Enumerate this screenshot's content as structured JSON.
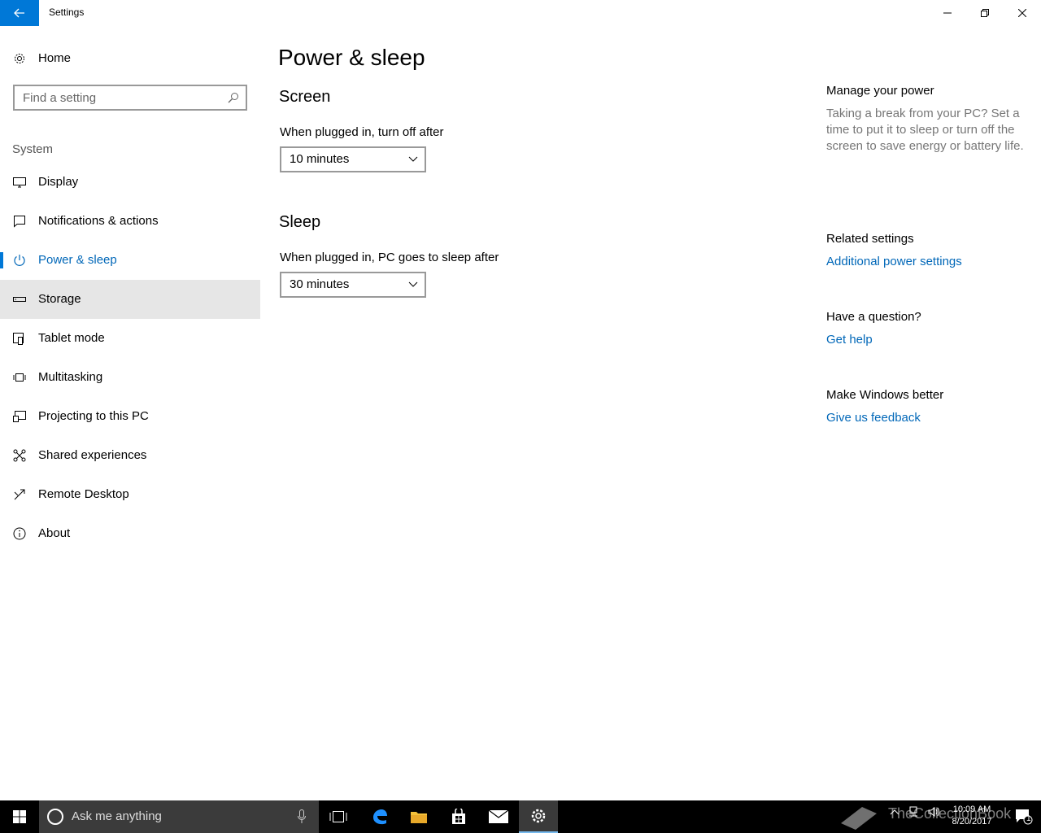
{
  "window": {
    "title": "Settings"
  },
  "sidebar": {
    "home_label": "Home",
    "search_placeholder": "Find a setting",
    "section_label": "System",
    "items": [
      {
        "label": "Display",
        "icon": "monitor-icon"
      },
      {
        "label": "Notifications & actions",
        "icon": "message-icon"
      },
      {
        "label": "Power & sleep",
        "icon": "power-icon",
        "active": true
      },
      {
        "label": "Storage",
        "icon": "drive-icon",
        "hover": true
      },
      {
        "label": "Tablet mode",
        "icon": "tablet-icon"
      },
      {
        "label": "Multitasking",
        "icon": "multitask-icon"
      },
      {
        "label": "Projecting to this PC",
        "icon": "project-icon"
      },
      {
        "label": "Shared experiences",
        "icon": "share-icon"
      },
      {
        "label": "Remote Desktop",
        "icon": "remote-icon"
      },
      {
        "label": "About",
        "icon": "info-icon"
      }
    ]
  },
  "main": {
    "title": "Power & sleep",
    "screen": {
      "heading": "Screen",
      "label": "When plugged in, turn off after",
      "value": "10 minutes"
    },
    "sleep": {
      "heading": "Sleep",
      "label": "When plugged in, PC goes to sleep after",
      "value": "30 minutes"
    }
  },
  "right": {
    "manage_heading": "Manage your power",
    "manage_text": "Taking a break from your PC? Set a time to put it to sleep or turn off the screen to save energy or battery life.",
    "related_heading": "Related settings",
    "related_link": "Additional power settings",
    "question_heading": "Have a question?",
    "help_link": "Get help",
    "better_heading": "Make Windows better",
    "feedback_link": "Give us feedback"
  },
  "taskbar": {
    "search_placeholder": "Ask me anything",
    "time": "10:09 AM",
    "date": "8/20/2017",
    "watermark": "TheCollectionBook",
    "notification_count": "1"
  },
  "colors": {
    "accent": "#0078d7",
    "link": "#0067b8",
    "taskbar": "#000000"
  }
}
